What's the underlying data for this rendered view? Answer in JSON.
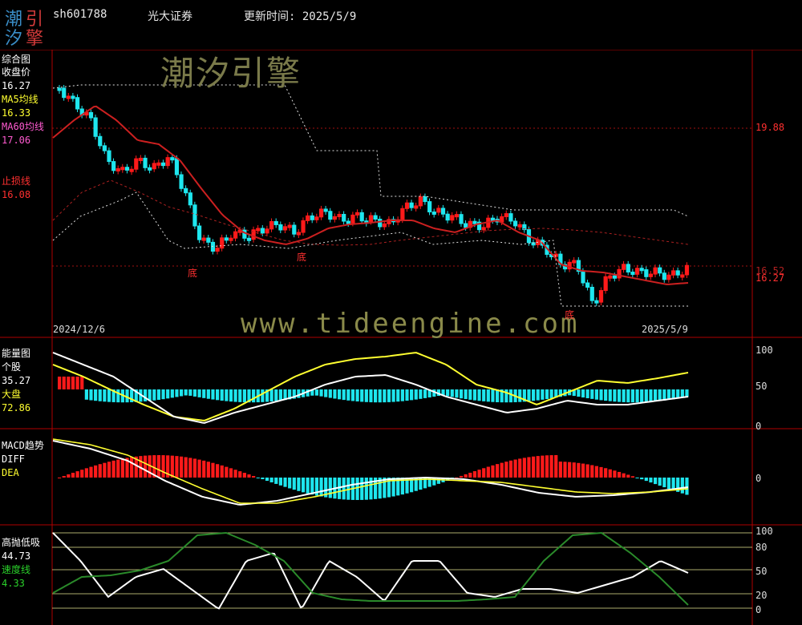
{
  "header": {
    "logo_chars": [
      "潮",
      "引",
      "汐",
      "擎"
    ],
    "code": "sh601788",
    "name": "光大证券",
    "update": "更新时间: 2025/5/9"
  },
  "watermark": {
    "cn": "潮汐引擎",
    "url": "www.tideengine.com"
  },
  "colors": {
    "frame": "#b00000",
    "up": "#ff1a1a",
    "down": "#1ee6ee",
    "ma5": "#ffffff",
    "ma60": "#cc2020",
    "yellow": "#ffff30",
    "green": "#2a8a2a",
    "grid": "#ffffa0"
  },
  "panel1": {
    "labels": [
      {
        "text": "综合图",
        "color": "#ffffff"
      },
      {
        "text": "收盘价",
        "color": "#ffffff"
      },
      {
        "text": "16.27",
        "color": "#ffffff"
      },
      {
        "text": "MA5均线",
        "color": "#ffff30"
      },
      {
        "text": "16.33",
        "color": "#ffff30"
      },
      {
        "text": "MA60均线",
        "color": "#ff5ad0"
      },
      {
        "text": "17.06",
        "color": "#ff5ad0"
      }
    ],
    "stoploss_label": "止损线",
    "stoploss_value": "16.08",
    "axis": [
      "19.88",
      "16.52",
      "16.27"
    ],
    "date_start": "2024/12/6",
    "date_end": "2025/5/9",
    "bottom_marks": [
      "底",
      "底",
      "底"
    ]
  },
  "panel2": {
    "labels": [
      "能量图",
      "个股",
      "35.27",
      "大盘",
      "72.86"
    ],
    "axis": [
      "100",
      "50",
      "0"
    ]
  },
  "panel3": {
    "labels": [
      "MACD趋势",
      "DIFF",
      "DEA"
    ],
    "axis": [
      "0"
    ]
  },
  "panel4": {
    "labels": [
      "高抛低吸",
      "44.73",
      "速度线",
      "4.33"
    ],
    "axis": [
      "100",
      "80",
      "50",
      "20",
      "0"
    ]
  }
}
